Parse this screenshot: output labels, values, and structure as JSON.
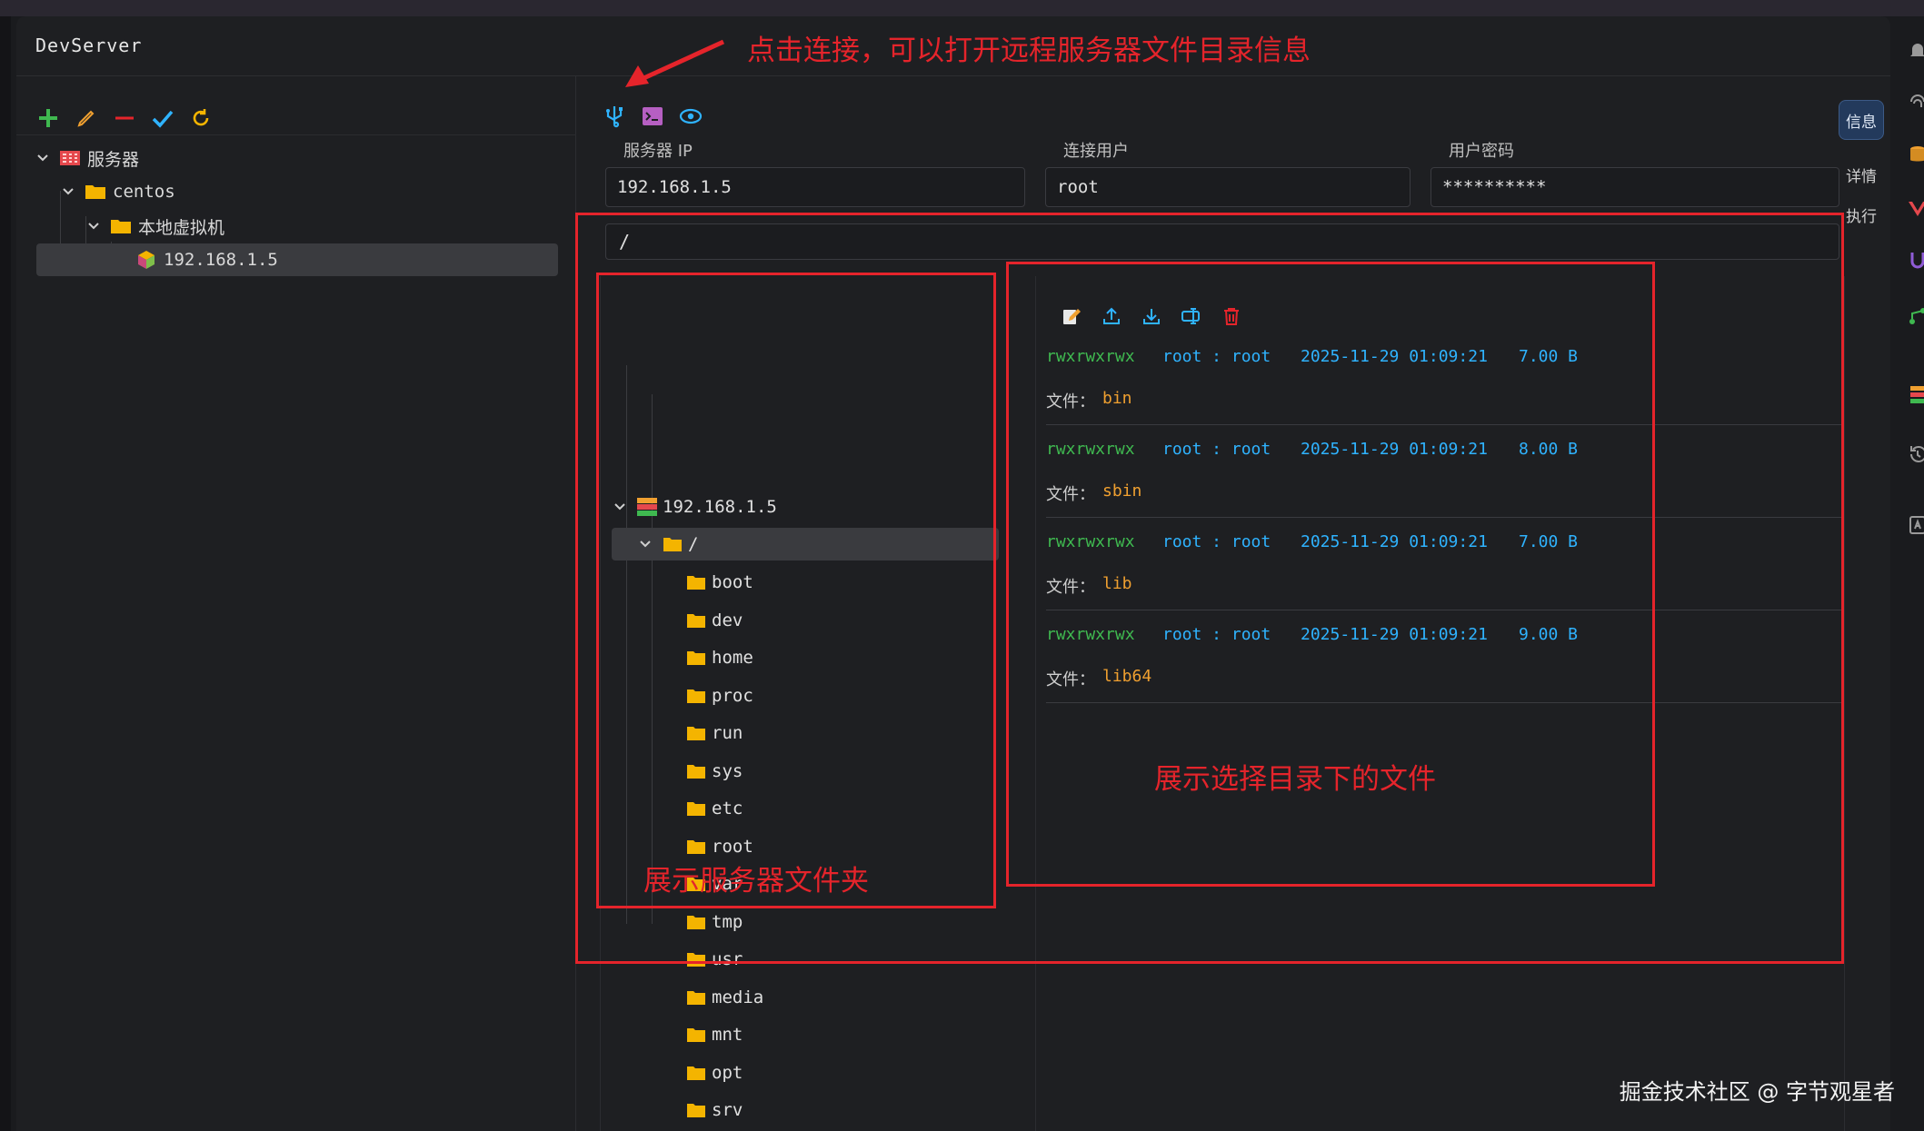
{
  "app": {
    "title": "DevServer"
  },
  "sidebar": {
    "tree": [
      {
        "label": "服务器"
      },
      {
        "label": "centos"
      },
      {
        "label": "本地虚拟机"
      },
      {
        "label": "192.168.1.5"
      }
    ]
  },
  "main": {
    "fields": {
      "server_ip": {
        "label": "服务器 IP",
        "value": "192.168.1.5"
      },
      "user": {
        "label": "连接用户",
        "value": "root"
      },
      "password": {
        "label": "用户密码",
        "value": "**********"
      }
    },
    "path": "/",
    "dir_tree": {
      "host": "192.168.1.5",
      "root": "/",
      "folders": [
        "boot",
        "dev",
        "home",
        "proc",
        "run",
        "sys",
        "etc",
        "root",
        "var",
        "tmp",
        "usr",
        "media",
        "mnt",
        "opt",
        "srv"
      ]
    },
    "files": {
      "file_label": "文件：",
      "entries": [
        {
          "perm": "rwxrwxrwx",
          "owner": "root : root",
          "time": "2025-11-29 01:09:21",
          "size": "7.00 B",
          "name": "bin"
        },
        {
          "perm": "rwxrwxrwx",
          "owner": "root : root",
          "time": "2025-11-29 01:09:21",
          "size": "8.00 B",
          "name": "sbin"
        },
        {
          "perm": "rwxrwxrwx",
          "owner": "root : root",
          "time": "2025-11-29 01:09:21",
          "size": "7.00 B",
          "name": "lib"
        },
        {
          "perm": "rwxrwxrwx",
          "owner": "root : root",
          "time": "2025-11-29 01:09:21",
          "size": "9.00 B",
          "name": "lib64"
        }
      ]
    }
  },
  "right_rail": {
    "info": "信息",
    "detail": "详情",
    "exec": "执行"
  },
  "annotations": {
    "connect": "点击连接，可以打开远程服务器文件目录信息",
    "folders": "展示服务器文件夹",
    "files": "展示选择目录下的文件"
  },
  "watermark": "掘金技术社区 @ 字节观星者",
  "icons": {
    "add": "plus-icon",
    "edit": "pencil-icon",
    "remove": "minus-icon",
    "confirm": "check-icon",
    "refresh": "refresh-icon",
    "connect": "usb-connect-icon",
    "terminal": "terminal-icon",
    "view": "eye-icon",
    "file_tools": [
      "edit-file-icon",
      "upload-icon",
      "download-icon",
      "rename-icon",
      "trash-icon"
    ]
  },
  "colors": {
    "accent_green": "#3fb950",
    "accent_blue": "#2fb3ff",
    "accent_orange": "#f0a030",
    "annotation_red": "#e5242b",
    "folder_yellow": "#f4b400"
  }
}
